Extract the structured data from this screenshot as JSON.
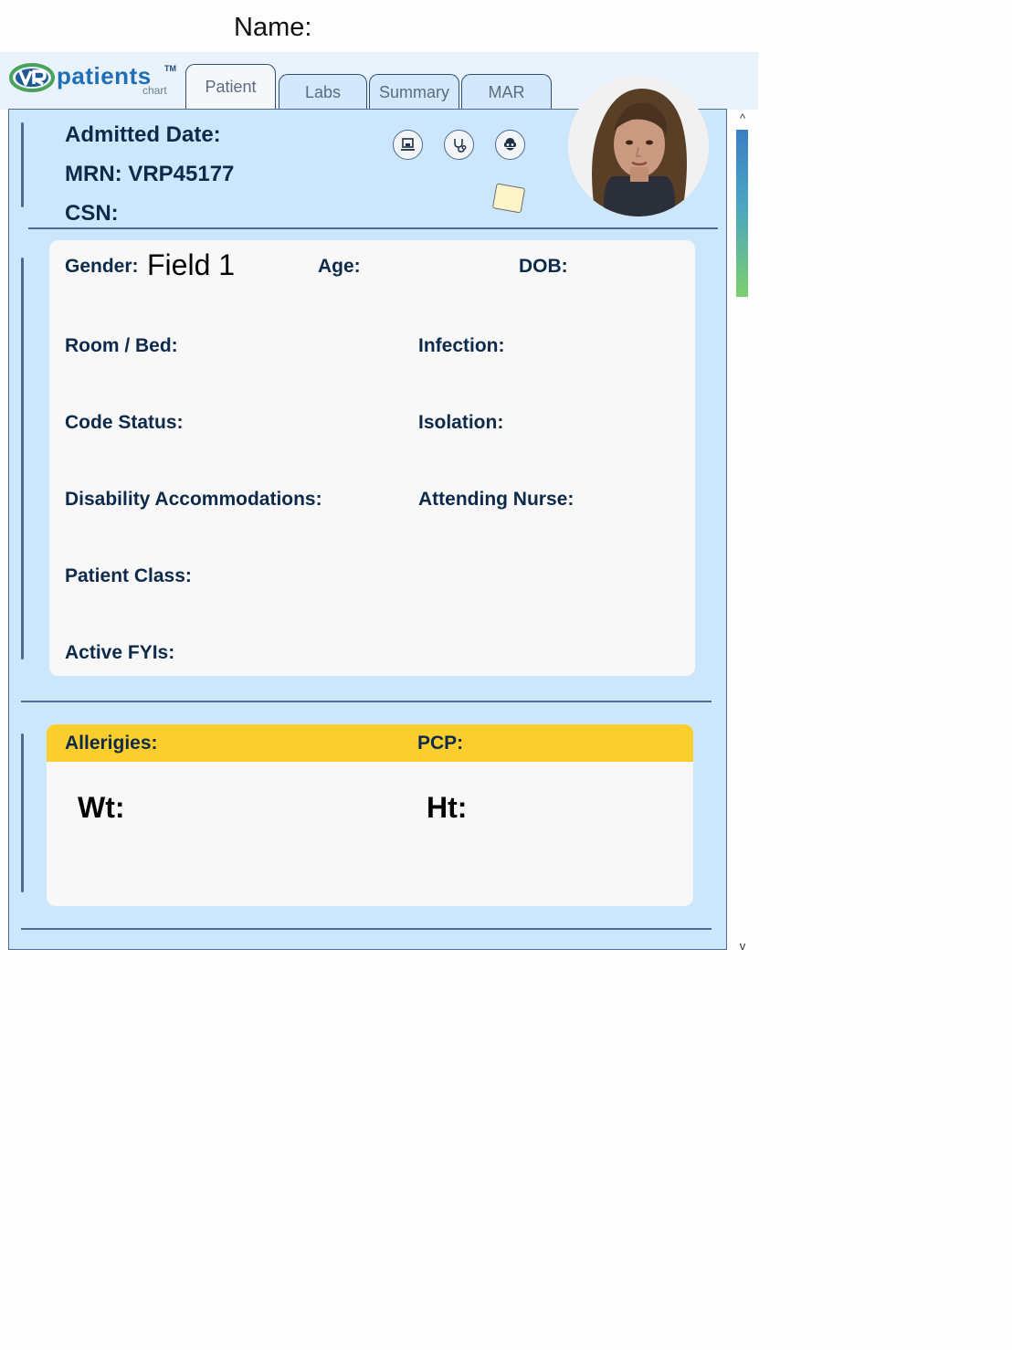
{
  "page": {
    "name_label": "Name:"
  },
  "logo": {
    "brand": "patients",
    "mark": "VR",
    "tm": "TM",
    "subtitle": "chart"
  },
  "tabs": [
    {
      "label": "Patient",
      "active": true
    },
    {
      "label": "Labs",
      "active": false
    },
    {
      "label": "Summary",
      "active": false
    },
    {
      "label": "MAR",
      "active": false
    }
  ],
  "header": {
    "admitted_date": "Admitted Date:",
    "mrn": "MRN: VRP45177",
    "csn": "CSN:",
    "icons": [
      "laptop-icon",
      "stethoscope-icon",
      "vr-headset-icon"
    ],
    "sticky_note": "sticky-note-icon"
  },
  "details": {
    "gender_label": "Gender:",
    "gender_value": "Field 1",
    "age_label": "Age:",
    "dob_label": "DOB:",
    "room_bed_label": "Room / Bed:",
    "infection_label": "Infection:",
    "code_status_label": "Code Status:",
    "isolation_label": "Isolation:",
    "disability_label": "Disability Accommodations:",
    "attending_nurse_label": "Attending Nurse:",
    "patient_class_label": "Patient Class:",
    "active_fyis_label": "Active FYIs:"
  },
  "vitals": {
    "allergies_label": "Allerigies:",
    "pcp_label": "PCP:",
    "wt_label": "Wt:",
    "ht_label": "Ht:"
  },
  "scroll": {
    "up": "^",
    "down": "v"
  },
  "colors": {
    "panel_bg": "#cce7fb",
    "card_bg": "#f8f8f8",
    "allergy_bar": "#fcce2d",
    "label_text": "#0d2a4a",
    "border": "#4d6a90"
  }
}
